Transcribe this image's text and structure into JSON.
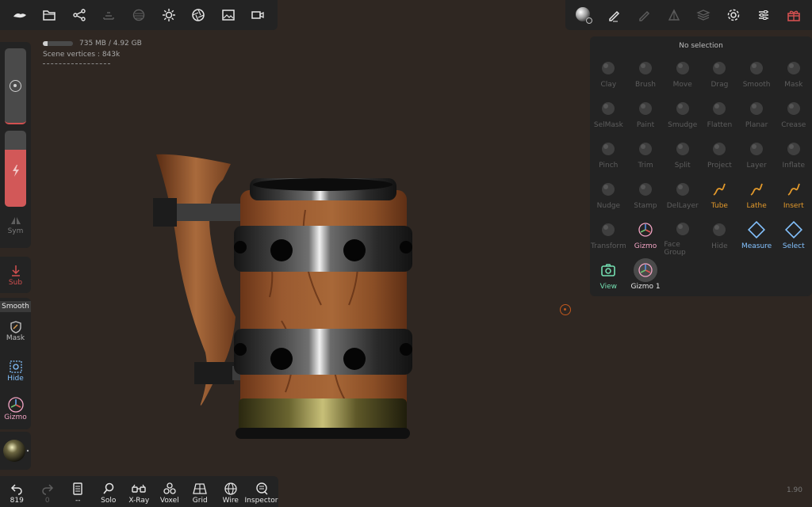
{
  "stats": {
    "memory": "735 MB / 4.92 GB",
    "memory_fraction": 0.15,
    "vertices": "Scene vertices : 843k"
  },
  "top_toolbar": {
    "icons": [
      "logo-icon",
      "folder-icon",
      "scene-graph-icon",
      "bricks-icon",
      "sphere-texture-icon",
      "light-icon",
      "post-process-icon",
      "background-image-icon",
      "camera-video-icon"
    ]
  },
  "top_right": {
    "icons": [
      "material-sphere-icon",
      "brush-settings-icon",
      "paint-icon",
      "topology-icon",
      "layers-icon",
      "settings-icon",
      "sliders-icon",
      "gift-icon"
    ]
  },
  "left": {
    "intensity_fraction": 0.75,
    "sym_label": "Sym",
    "sub_label": "Sub",
    "tools": [
      {
        "label": "Smooth"
      },
      {
        "label": "Mask"
      },
      {
        "label": "Hide"
      },
      {
        "label": "Gizmo"
      }
    ]
  },
  "tool_panel": {
    "header": "No selection",
    "tools": [
      {
        "label": "Clay",
        "state": "off"
      },
      {
        "label": "Brush",
        "state": "off"
      },
      {
        "label": "Move",
        "state": "off"
      },
      {
        "label": "Drag",
        "state": "off"
      },
      {
        "label": "Smooth",
        "state": "off"
      },
      {
        "label": "Mask",
        "state": "off"
      },
      {
        "label": "SelMask",
        "state": "off"
      },
      {
        "label": "Paint",
        "state": "off"
      },
      {
        "label": "Smudge",
        "state": "off"
      },
      {
        "label": "Flatten",
        "state": "off"
      },
      {
        "label": "Planar",
        "state": "off"
      },
      {
        "label": "Crease",
        "state": "off"
      },
      {
        "label": "Pinch",
        "state": "off"
      },
      {
        "label": "Trim",
        "state": "off"
      },
      {
        "label": "Split",
        "state": "off"
      },
      {
        "label": "Project",
        "state": "off"
      },
      {
        "label": "Layer",
        "state": "off"
      },
      {
        "label": "Inflate",
        "state": "off"
      },
      {
        "label": "Nudge",
        "state": "off"
      },
      {
        "label": "Stamp",
        "state": "off"
      },
      {
        "label": "DelLayer",
        "state": "off"
      },
      {
        "label": "Tube",
        "state": "on"
      },
      {
        "label": "Lathe",
        "state": "on"
      },
      {
        "label": "Insert",
        "state": "on"
      },
      {
        "label": "Transform",
        "state": "off"
      },
      {
        "label": "Gizmo",
        "state": "pink"
      },
      {
        "label": "Face Group",
        "state": "off"
      },
      {
        "label": "Hide",
        "state": "off"
      },
      {
        "label": "Measure",
        "state": "blue"
      },
      {
        "label": "Select",
        "state": "blue"
      },
      {
        "label": "View",
        "state": "teal"
      },
      {
        "label": "Gizmo 1",
        "state": "sel"
      }
    ]
  },
  "bottom_bar": {
    "items": [
      {
        "label": "819",
        "icon": "undo-icon"
      },
      {
        "label": "0",
        "icon": "redo-icon"
      },
      {
        "label": "--",
        "icon": "document-icon"
      },
      {
        "label": "Solo",
        "icon": "search-icon"
      },
      {
        "label": "X-Ray",
        "icon": "glasses-icon"
      },
      {
        "label": "Voxel",
        "icon": "voxel-icon"
      },
      {
        "label": "Grid",
        "icon": "grid-icon"
      },
      {
        "label": "Wire",
        "icon": "wireframe-icon"
      },
      {
        "label": "Inspector",
        "icon": "inspector-icon"
      }
    ]
  },
  "fps": "1.90",
  "colors": {
    "background": "#2f2722",
    "panel": "#232323",
    "accent_orange": "#e49a2b",
    "accent_blue": "#84c2ff",
    "accent_red": "#d25858"
  }
}
